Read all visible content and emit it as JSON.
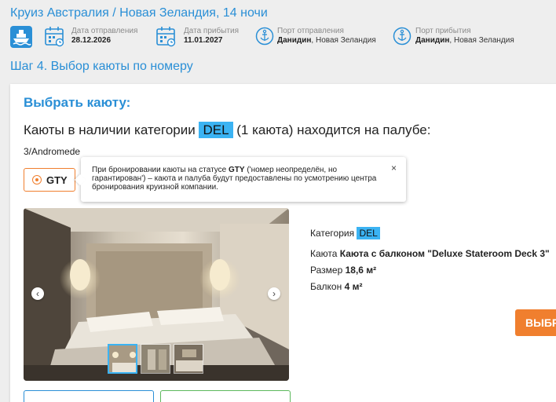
{
  "header": {
    "title": "Круиз Австралия / Новая Зеландия, 14 ночи",
    "departure_date": {
      "label": "Дата отправления",
      "value": "28.12.2026"
    },
    "arrival_date": {
      "label": "Дата прибытия",
      "value": "11.01.2027"
    },
    "departure_port": {
      "label": "Порт отправления",
      "city": "Данидин",
      "country": ", Новая Зеландия"
    },
    "arrival_port": {
      "label": "Порт прибытия",
      "city": "Данидин",
      "country": ", Новая Зеландия"
    }
  },
  "step": "Шаг 4. Выбор каюты по номеру",
  "card": {
    "heading": "Выбрать каюту:",
    "availability_prefix": "Каюты в наличии категории",
    "category_code": "DEL",
    "availability_suffix": "(1 каюта) находится на палубе:",
    "deck": "3/Andromede",
    "option_label": "GTY",
    "tooltip": {
      "before": "При бронировании каюты на статусе ",
      "bold": "GTY",
      "after": " ('номер неопределён, но гарантирован') – каюта и палуба будут предоставлены по усмотрению центра бронирования круизной компании.",
      "close": "×"
    },
    "cabin_info": {
      "category_label": "Категория",
      "category_value": "DEL",
      "cabin_label": "Каюта",
      "cabin_value": "Каюта с балконом \"Deluxe Stateroom Deck 3\"",
      "size_label": "Размер",
      "size_value": "18,6 м²",
      "balcony_label": "Балкон",
      "balcony_value": "4 м²"
    },
    "book_button": "ВЫБРАТЬ",
    "gallery_prev": "‹",
    "gallery_next": "›"
  },
  "colors": {
    "accent_blue": "#2a8fd6",
    "tag_blue": "#3bb3f3",
    "orange": "#f07f2e",
    "green": "#5cb85c"
  }
}
